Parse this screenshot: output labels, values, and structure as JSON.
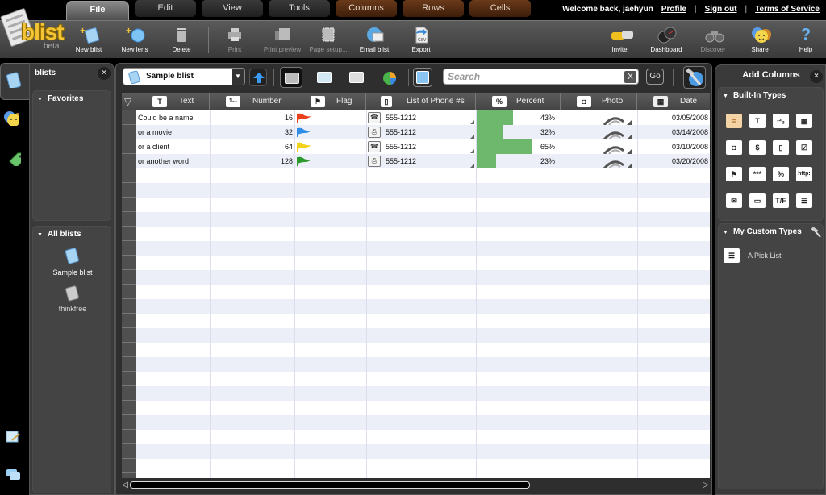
{
  "top_tabs": [
    {
      "label": "File",
      "active": true
    },
    {
      "label": "Edit",
      "active": false
    },
    {
      "label": "View",
      "active": false
    },
    {
      "label": "Tools",
      "active": false
    },
    {
      "label": "Columns",
      "active": false
    },
    {
      "label": "Rows",
      "active": false
    },
    {
      "label": "Cells",
      "active": false
    }
  ],
  "user_bar": {
    "welcome": "Welcome back, jaehyun",
    "profile": "Profile",
    "sign_out": "Sign out",
    "terms": "Terms of Service",
    "separator": "|"
  },
  "logo": {
    "name": "blist",
    "tag": "beta"
  },
  "toolbar": {
    "new_blist": "New blist",
    "new_lens": "New lens",
    "delete": "Delete",
    "print": "Print",
    "print_preview": "Print preview",
    "page_setup": "Page setup...",
    "email_blist": "Email blist",
    "export": "Export",
    "export_badge": "csv",
    "invite": "Invite",
    "dashboard": "Dashboard",
    "discover": "Discover",
    "share": "Share",
    "help": "Help"
  },
  "left_panel": {
    "title": "blists",
    "favorites": "Favorites",
    "all_blists": "All blists",
    "items": [
      {
        "label": "Sample blist"
      },
      {
        "label": "thinkfree"
      }
    ]
  },
  "main": {
    "selected_blist": "Sample blist",
    "search_placeholder": "Search",
    "search_clear": "X",
    "go": "Go"
  },
  "grid": {
    "columns": [
      {
        "label": "Text",
        "icon": "T"
      },
      {
        "label": "Number",
        "icon": "1₂₃"
      },
      {
        "label": "Flag",
        "icon": "⚑"
      },
      {
        "label": "List of Phone #s",
        "icon": "▯"
      },
      {
        "label": "Percent",
        "icon": "%"
      },
      {
        "label": "Photo",
        "icon": "◘"
      },
      {
        "label": "Date",
        "icon": "▦"
      }
    ],
    "rows": [
      {
        "text": "Could be a name",
        "number": "16",
        "flag": "red",
        "phone_type": "phone",
        "phone": "555-1212",
        "percent": "43%",
        "percent_value": 43,
        "date": "03/05/2008"
      },
      {
        "text": "or a movie",
        "number": "32",
        "flag": "blue",
        "phone_type": "fax",
        "phone": "555-1212",
        "percent": "32%",
        "percent_value": 32,
        "date": "03/14/2008"
      },
      {
        "text": "or a client",
        "number": "64",
        "flag": "yellow",
        "phone_type": "phone",
        "phone": "555-1212",
        "percent": "65%",
        "percent_value": 65,
        "date": "03/10/2008"
      },
      {
        "text": "or another word",
        "number": "128",
        "flag": "green",
        "phone_type": "fax",
        "phone": "555-1212",
        "percent": "23%",
        "percent_value": 23,
        "date": "03/20/2008"
      }
    ],
    "flag_colors": {
      "red": "#e8401a",
      "blue": "#2f8ce8",
      "yellow": "#f2d21a",
      "green": "#2c9a2c"
    },
    "percent_color": "#6db86d"
  },
  "right_panel": {
    "title": "Add Columns",
    "built_in": "Built-In Types",
    "custom": "My Custom Types",
    "custom_items": [
      {
        "label": "A Pick List"
      }
    ],
    "types": [
      {
        "name": "rich-text",
        "glyph": "≡"
      },
      {
        "name": "text",
        "glyph": "T"
      },
      {
        "name": "number",
        "glyph": "¹²₃"
      },
      {
        "name": "date",
        "glyph": "▦"
      },
      {
        "name": "photo",
        "glyph": "◘"
      },
      {
        "name": "money",
        "glyph": "$"
      },
      {
        "name": "phone",
        "glyph": "▯"
      },
      {
        "name": "checkbox",
        "glyph": "☑"
      },
      {
        "name": "flag",
        "glyph": "⚑"
      },
      {
        "name": "stars",
        "glyph": "***"
      },
      {
        "name": "percent",
        "glyph": "%"
      },
      {
        "name": "url",
        "glyph": "http:"
      },
      {
        "name": "email",
        "glyph": "✉"
      },
      {
        "name": "document",
        "glyph": "▭"
      },
      {
        "name": "tag",
        "glyph": "T/F"
      },
      {
        "name": "picklist",
        "glyph": "☰"
      }
    ]
  }
}
